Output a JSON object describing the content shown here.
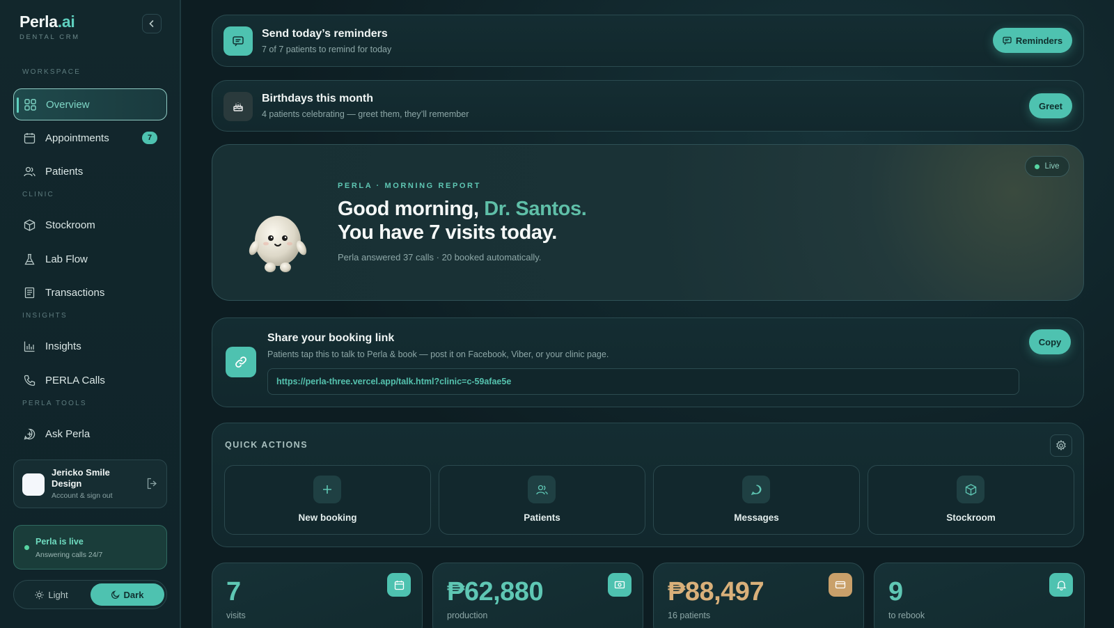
{
  "brand": {
    "name_main": "Perla",
    "name_accent": ".ai",
    "subtitle": "DENTAL CRM"
  },
  "sidebar": {
    "sections": {
      "workspace": "WORKSPACE",
      "clinic": "CLINIC",
      "insights": "INSIGHTS",
      "tools": "PERLA TOOLS"
    },
    "items": [
      {
        "label": "Overview",
        "icon": "grid-icon",
        "active": true
      },
      {
        "label": "Appointments",
        "icon": "calendar-icon",
        "badge": "7"
      },
      {
        "label": "Patients",
        "icon": "users-icon"
      },
      {
        "label": "Stockroom",
        "icon": "box-icon"
      },
      {
        "label": "Lab Flow",
        "icon": "flask-icon"
      },
      {
        "label": "Transactions",
        "icon": "receipt-icon"
      },
      {
        "label": "Insights",
        "icon": "bar-chart-icon"
      },
      {
        "label": "PERLA Calls",
        "icon": "phone-icon"
      },
      {
        "label": "Ask Perla",
        "icon": "chat-icon"
      }
    ],
    "account": {
      "name": "Jericko Smile Design",
      "sub": "Account & sign out"
    },
    "live": {
      "title": "Perla is live",
      "sub": "Answering calls 24/7"
    },
    "theme": {
      "light": "Light",
      "dark": "Dark",
      "selected": "Dark"
    }
  },
  "reminders": {
    "title": "Send today’s reminders",
    "sub": "7 of 7 patients to remind for today",
    "button": "Reminders"
  },
  "birthdays": {
    "title": "Birthdays this month",
    "sub": "4 patients celebrating — greet them, they’ll remember",
    "button": "Greet"
  },
  "hero": {
    "kicker": "PERLA · MORNING REPORT",
    "greeting": "Good morning, ",
    "doctor": "Dr. Santos.",
    "line2": "You have 7 visits today.",
    "sub": "Perla answered 37 calls · 20 booked automatically.",
    "live": "Live"
  },
  "booking": {
    "title": "Share your booking link",
    "sub": "Patients tap this to talk to Perla & book — post it on Facebook, Viber, or your clinic page.",
    "url": "https://perla-three.vercel.app/talk.html?clinic=c-59afae5e",
    "button": "Copy"
  },
  "quick_actions": {
    "title": "QUICK ACTIONS",
    "items": [
      {
        "label": "New booking",
        "icon": "plus-icon"
      },
      {
        "label": "Patients",
        "icon": "users-icon"
      },
      {
        "label": "Messages",
        "icon": "chat-bubble-icon"
      },
      {
        "label": "Stockroom",
        "icon": "box-icon"
      }
    ]
  },
  "stats": [
    {
      "value": "7",
      "label": "visits",
      "icon": "calendar-icon",
      "color": "#4ec2b0"
    },
    {
      "value": "₱62,880",
      "label": "production",
      "icon": "money-icon",
      "color": "#4ec2b0"
    },
    {
      "value": "₱88,497",
      "label": "16 patients",
      "icon": "card-icon",
      "color": "#c9a06a"
    },
    {
      "value": "9",
      "label": "to rebook",
      "icon": "bell-icon",
      "color": "#4ec2b0"
    }
  ]
}
